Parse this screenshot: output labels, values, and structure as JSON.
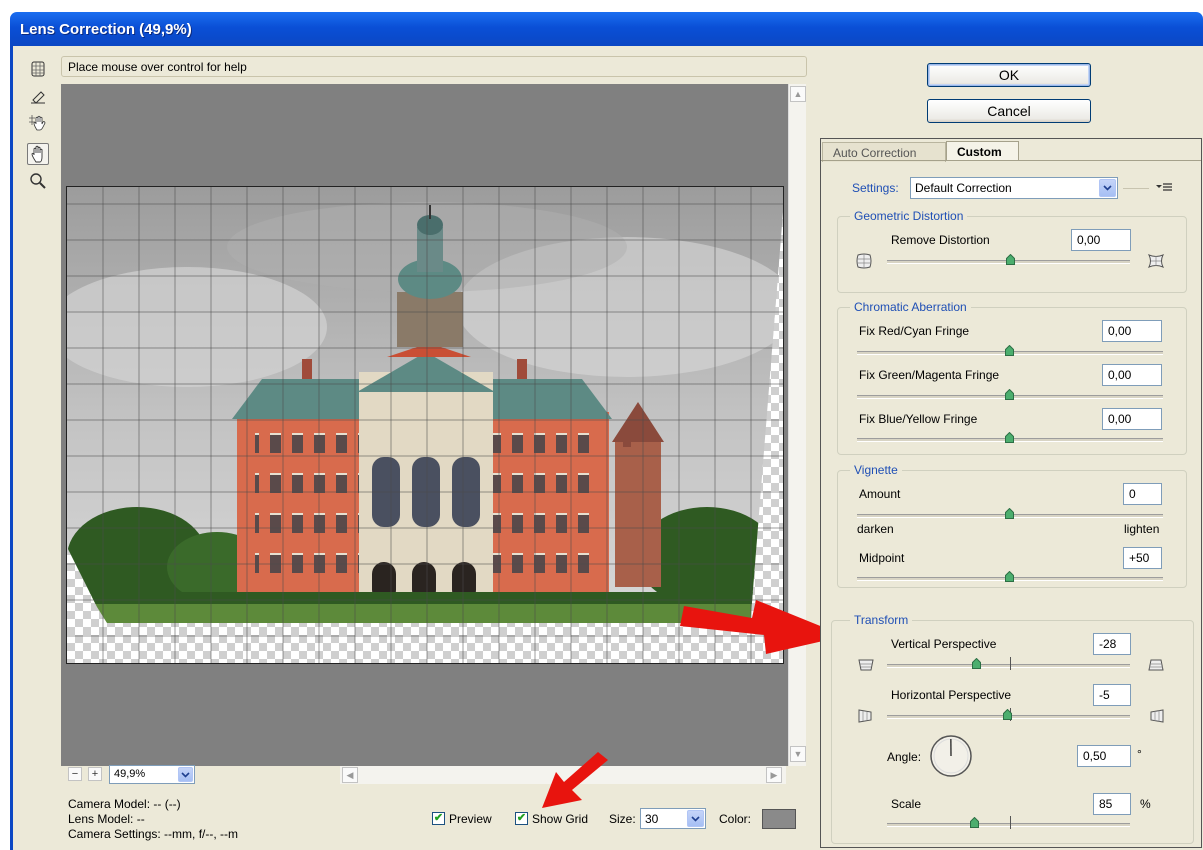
{
  "window": {
    "title": "Lens Correction (49,9%)"
  },
  "help": {
    "text": "Place mouse over control for help"
  },
  "tools": [
    "remove-distortion-tool-icon",
    "straighten-tool-icon",
    "move-grid-tool-icon",
    "hand-tool-icon",
    "zoom-tool-icon"
  ],
  "zoom": {
    "value": "49,9%"
  },
  "camera": {
    "model": "Camera Model: -- (--)",
    "lens": "Lens Model: --",
    "settings": "Camera Settings: --mm, f/--, --m"
  },
  "preview": {
    "label": "Preview",
    "checked": true
  },
  "show_grid": {
    "label": "Show Grid",
    "checked": true
  },
  "grid_size": {
    "label": "Size:",
    "value": "30"
  },
  "grid_color": {
    "label": "Color:",
    "value": "#8a8a8a"
  },
  "buttons": {
    "ok": "OK",
    "cancel": "Cancel"
  },
  "tabs": [
    {
      "label": "Auto Correction",
      "active": false
    },
    {
      "label": "Custom",
      "active": true
    }
  ],
  "settings": {
    "label": "Settings:",
    "value": "Default Correction"
  },
  "geometric": {
    "title": "Geometric Distortion",
    "remove_label": "Remove Distortion",
    "remove_value": "0,00"
  },
  "chromatic": {
    "title": "Chromatic Aberration",
    "red_cyan_label": "Fix Red/Cyan Fringe",
    "red_cyan_value": "0,00",
    "green_magenta_label": "Fix Green/Magenta Fringe",
    "green_magenta_value": "0,00",
    "blue_yellow_label": "Fix Blue/Yellow Fringe",
    "blue_yellow_value": "0,00"
  },
  "vignette": {
    "title": "Vignette",
    "amount_label": "Amount",
    "amount_value": "0",
    "darken": "darken",
    "lighten": "lighten",
    "midpoint_label": "Midpoint",
    "midpoint_value": "+50"
  },
  "transform": {
    "title": "Transform",
    "vertical_label": "Vertical Perspective",
    "vertical_value": "-28",
    "horizontal_label": "Horizontal Perspective",
    "horizontal_value": "-5",
    "angle_label": "Angle:",
    "angle_value": "0,50",
    "angle_unit": "°",
    "scale_label": "Scale",
    "scale_value": "85",
    "scale_unit": "%"
  },
  "colors": {
    "titlebar": "#0b47c4",
    "group_title": "#1f4fb5",
    "annotation_arrow": "#e8140e",
    "dialog_bg": "#ece9d8"
  }
}
